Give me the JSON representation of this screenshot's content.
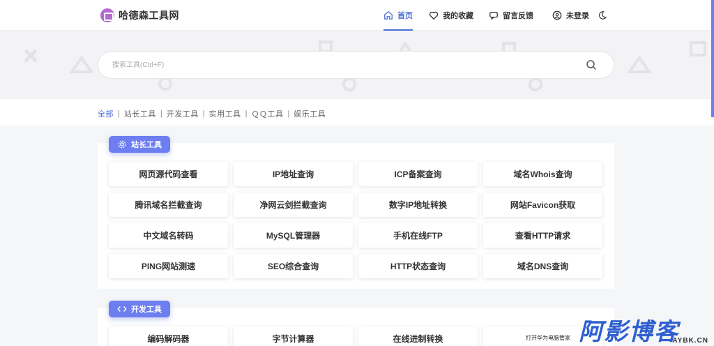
{
  "header": {
    "logo_text": "哈德森工具网",
    "nav": [
      {
        "label": "首页",
        "icon": "home-icon",
        "active": true
      },
      {
        "label": "我的收藏",
        "icon": "heart-icon",
        "active": false
      },
      {
        "label": "留言反馈",
        "icon": "chat-icon",
        "active": false
      },
      {
        "label": "未登录",
        "icon": "user-icon",
        "active": false
      }
    ],
    "theme_icon": "moon-icon"
  },
  "search": {
    "placeholder": "搜索工具(Ctrl+F)",
    "icon": "search-icon"
  },
  "categories": {
    "items": [
      "全部",
      "站长工具",
      "开发工具",
      "实用工具",
      "ＱＱ工具",
      "娱乐工具"
    ],
    "active_index": 0
  },
  "sections": [
    {
      "title": "站长工具",
      "icon": "gear-icon",
      "tools": [
        "网页源代码查看",
        "IP地址查询",
        "ICP备案查询",
        "域名Whois查询",
        "腾讯域名拦截查询",
        "净网云剑拦截查询",
        "数字IP地址转换",
        "网站Favicon获取",
        "中文域名转码",
        "MySQL管理器",
        "手机在线FTP",
        "查看HTTP请求",
        "PING网站测速",
        "SEO综合查询",
        "HTTP状态查询",
        "域名DNS查询"
      ]
    },
    {
      "title": "开发工具",
      "icon": "code-icon",
      "tools": [
        "编码解码器",
        "字节计算器",
        "在线进制转换",
        ""
      ]
    }
  ],
  "widget": {
    "label": "打开华为电脑管家"
  },
  "watermark": {
    "text": "阿影博客",
    "sub": "AYBK.CN"
  },
  "colors": {
    "accent": "#4b6fd6",
    "badge": "#6c7ef0",
    "logo": "#b46bd0"
  }
}
